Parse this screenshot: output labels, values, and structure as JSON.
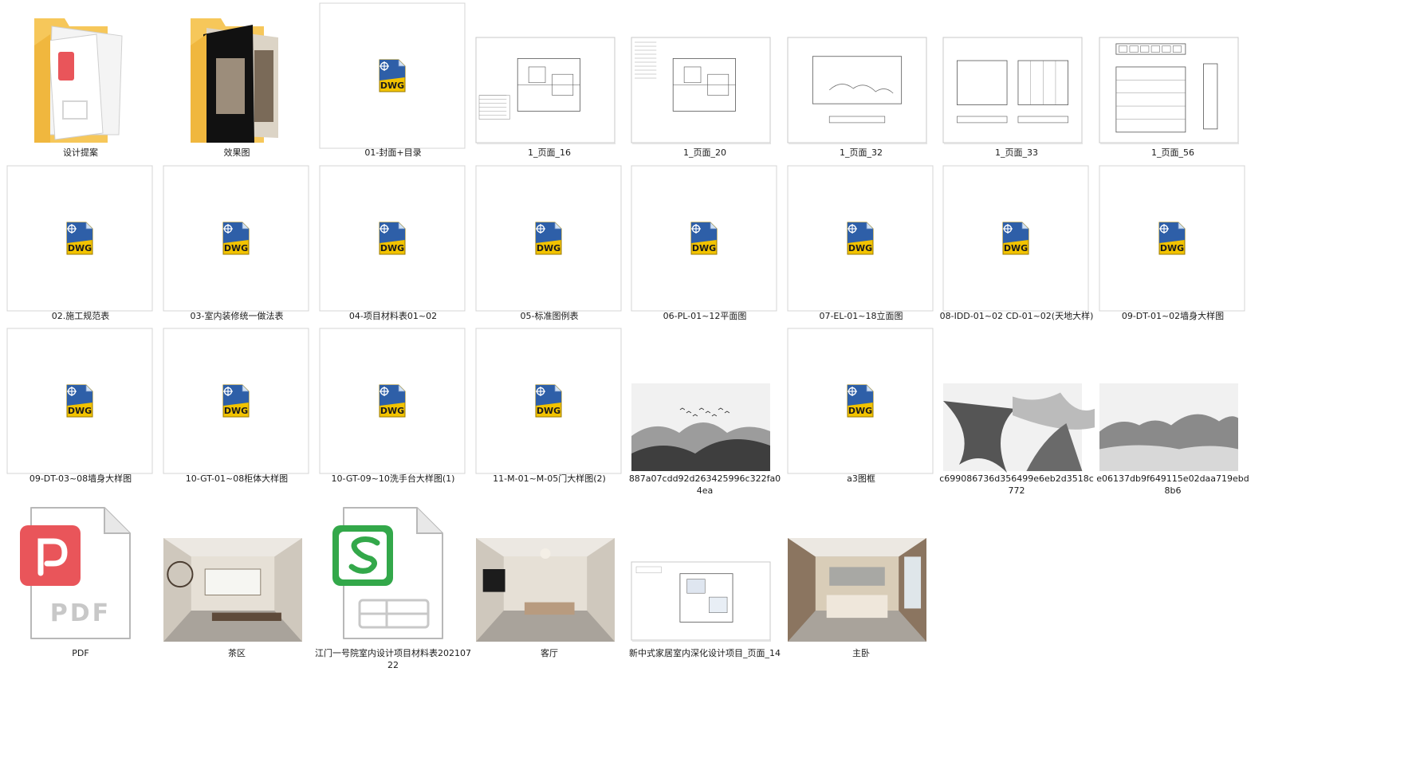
{
  "rows": [
    [
      {
        "label": "设计提案",
        "kind": "folder-pdf"
      },
      {
        "label": "效果图",
        "kind": "folder-photo"
      },
      {
        "label": "01-封面+目录",
        "kind": "dwg"
      },
      {
        "label": "1_页面_16",
        "kind": "drawing-plan"
      },
      {
        "label": "1_页面_20",
        "kind": "drawing-plan2"
      },
      {
        "label": "1_页面_32",
        "kind": "drawing-elev"
      },
      {
        "label": "1_页面_33",
        "kind": "drawing-elev2"
      },
      {
        "label": "1_页面_56",
        "kind": "drawing-detail"
      }
    ],
    [
      {
        "label": "02.施工规范表",
        "kind": "dwg"
      },
      {
        "label": "03-室内装修统一做法表",
        "kind": "dwg"
      },
      {
        "label": "04-项目材料表01~02",
        "kind": "dwg"
      },
      {
        "label": "05-标准图例表",
        "kind": "dwg"
      },
      {
        "label": "06-PL-01~12平面图",
        "kind": "dwg"
      },
      {
        "label": "07-EL-01~18立面图",
        "kind": "dwg"
      },
      {
        "label": "08-IDD-01~02 CD-01~02(天地大样)",
        "kind": "dwg"
      },
      {
        "label": "09-DT-01~02墙身大样图",
        "kind": "dwg"
      }
    ],
    [
      {
        "label": "09-DT-03~08墙身大样图",
        "kind": "dwg"
      },
      {
        "label": "10-GT-01~08柜体大样图",
        "kind": "dwg"
      },
      {
        "label": "10-GT-09~10洗手台大样图(1)",
        "kind": "dwg"
      },
      {
        "label": "11-M-01~M-05门大样图(2)",
        "kind": "dwg"
      },
      {
        "label": "887a07cdd92d263425996c322fa04ea",
        "kind": "ink-1"
      },
      {
        "label": "a3图框",
        "kind": "dwg"
      },
      {
        "label": "c699086736d356499e6eb2d3518c772",
        "kind": "ink-2"
      },
      {
        "label": "e06137db9f649115e02daa719ebd8b6",
        "kind": "ink-3"
      }
    ],
    [
      {
        "label": "PDF",
        "kind": "pdf-file"
      },
      {
        "label": "茶区",
        "kind": "photo-tea"
      },
      {
        "label": "江门一号院室内设计项目材料表20210722",
        "kind": "xls-file"
      },
      {
        "label": "客厅",
        "kind": "photo-living"
      },
      {
        "label": "新中式家居室内深化设计项目_页面_14",
        "kind": "drawing-layout"
      },
      {
        "label": "主卧",
        "kind": "photo-bedroom"
      }
    ]
  ],
  "dwg_text": "DWG",
  "pdf_text": "PDF",
  "colors": {
    "dwg_blue": "#2e5fa8",
    "dwg_yellow": "#f2c300",
    "pdf_red": "#e9555a",
    "xls_green": "#33a84a",
    "folder": "#f6c75a"
  }
}
